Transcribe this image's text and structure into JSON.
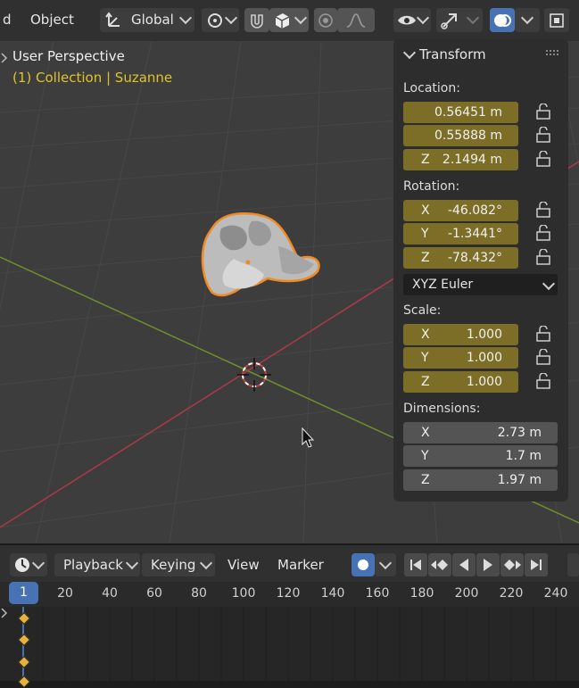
{
  "header": {
    "mode_fragment": "d",
    "object_menu": "Object",
    "orientation": "Global"
  },
  "viewport": {
    "view_name": "User Perspective",
    "collection_info": "(1) Collection | Suzanne"
  },
  "npanel": {
    "title": "Transform",
    "location_label": "Location:",
    "location": [
      {
        "axis": "",
        "value": "0.56451 m"
      },
      {
        "axis": "",
        "value": "0.55888 m"
      },
      {
        "axis": "Z",
        "value": "2.1494 m"
      }
    ],
    "rotation_label": "Rotation:",
    "rotation": [
      {
        "axis": "X",
        "value": "-46.082°"
      },
      {
        "axis": "Y",
        "value": "-1.3441°"
      },
      {
        "axis": "Z",
        "value": "-78.432°"
      }
    ],
    "rotation_mode": "XYZ Euler",
    "scale_label": "Scale:",
    "scale": [
      {
        "axis": "X",
        "value": "1.000"
      },
      {
        "axis": "Y",
        "value": "1.000"
      },
      {
        "axis": "Z",
        "value": "1.000"
      }
    ],
    "dimensions_label": "Dimensions:",
    "dimensions": [
      {
        "axis": "X",
        "value": "2.73 m"
      },
      {
        "axis": "Y",
        "value": "1.7 m"
      },
      {
        "axis": "Z",
        "value": "1.97 m"
      }
    ]
  },
  "timeline": {
    "playback": "Playback",
    "keying": "Keying",
    "view": "View",
    "marker": "Marker",
    "current_frame": "1",
    "ticks": [
      "20",
      "40",
      "60",
      "80",
      "100",
      "120",
      "140",
      "160",
      "180",
      "200",
      "220",
      "240"
    ]
  },
  "colors": {
    "field_animated": "#7d6e27",
    "accent": "#4772b3",
    "selection_outline": "#f08a24",
    "keyframe": "#e8b23a",
    "collection_text": "#e0c22a"
  }
}
